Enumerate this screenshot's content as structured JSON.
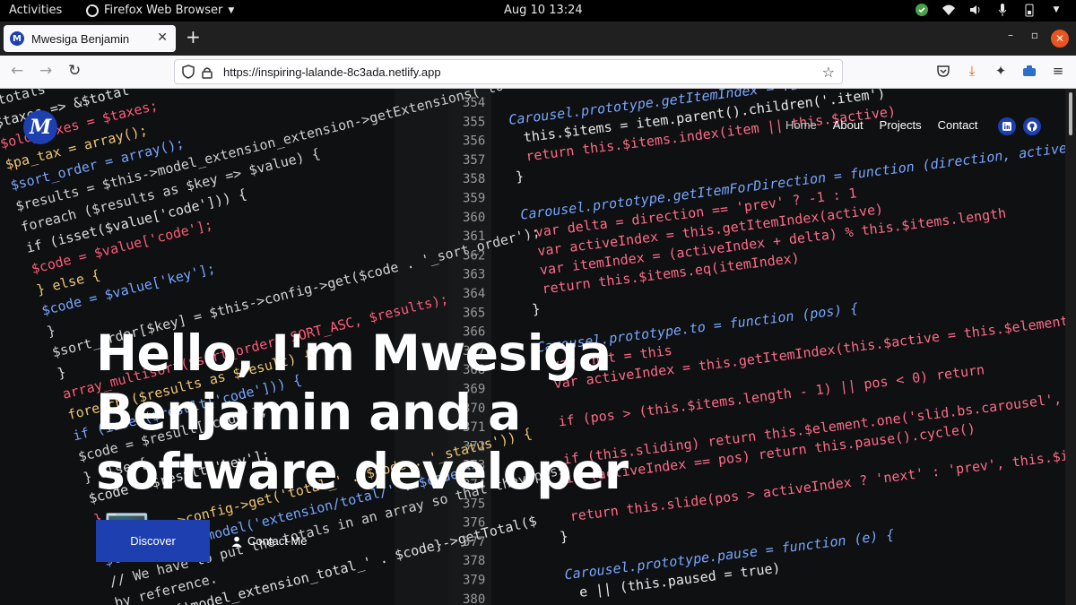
{
  "system_bar": {
    "activities": "Activities",
    "app_name": "Firefox Web Browser",
    "clock": "Aug 10  13:24"
  },
  "browser": {
    "tab_title": "Mwesiga Benjamin",
    "url": "https://inspiring-lalande-8c3ada.netlify.app"
  },
  "site": {
    "logo_letter": "M",
    "nav": [
      "Home",
      "About",
      "Projects",
      "Contact"
    ],
    "hero_line1": "Hello, I'm Mwesiga",
    "hero_line2": "Benjamin and a",
    "hero_line3": "software developer💻.",
    "discover_label": "Discover",
    "contact_label": "Contact Me"
  },
  "code_background": {
    "left_lines": [
      "$totals = ...;",
      "$taxes => &$total",
      "$old_taxes = $taxes;",
      "$pa_tax = array();",
      "$sort_order = array();",
      "$results = $this->model_extension_extension->getExtensions('total');",
      "foreach ($results as $key => $value) {",
      "if (isset($value['code'])) {",
      "$code = $value['code'];",
      "} else {",
      "$code = $value['key'];",
      "}",
      "$sort_order[$key] = $this->config->get($code . '_sort_order');",
      "}",
      "array_multisort($sort_order, SORT_ASC, $results);",
      "foreach ($results as $result) {",
      "if (isset($result['code'])) {",
      "$code = $result['code'];",
      "} else {",
      "$code = $result['key'];",
      "}",
      "if ($this->config->get('total_' . $code . '_status')) {",
      "$this->load->model('extension/total/' . $code);",
      "// We have to put the totals in an array so that they pass",
      "by reference.",
      "$this->{'model_extension_total_' . $code}->getTotal($"
    ],
    "line_numbers": [
      "354",
      "355",
      "356",
      "357",
      "358",
      "359",
      "360",
      "361",
      "362",
      "363",
      "364",
      "365",
      "366",
      "367",
      "368",
      "369",
      "370",
      "371",
      "372",
      "373",
      "374",
      "375",
      "376",
      "377",
      "378",
      "379",
      "380"
    ],
    "right_lines": [
      "Carousel.prototype.getItemIndex = function (item) {",
      "this.$items = item.parent().children('.item')",
      "return this.$items.index(item || this.$active)",
      "}",
      "",
      "Carousel.prototype.getItemForDirection = function (direction, active) {",
      "var delta = direction == 'prev' ? -1 : 1",
      "var activeIndex = this.getItemIndex(active)",
      "var itemIndex = (activeIndex + delta) % this.$items.length",
      "return this.$items.eq(itemIndex)",
      "}",
      "",
      "Carousel.prototype.to = function (pos) {",
      "var that        = this",
      "var activeIndex = this.getItemIndex(this.$active = this.$element.find('.item.active'))",
      "",
      "if (pos > (this.$items.length - 1) || pos < 0) return",
      "",
      "if (this.sliding)       return this.$element.one('slid.bs.carousel', function () { that.to(pos) })",
      "if (activeIndex == pos) return this.pause().cycle()",
      "",
      "return this.slide(pos > activeIndex ? 'next' : 'prev', this.$items.eq(pos))",
      "}",
      "",
      "Carousel.prototype.pause = function (e) {",
      "e || (this.paused = true)",
      ""
    ]
  }
}
